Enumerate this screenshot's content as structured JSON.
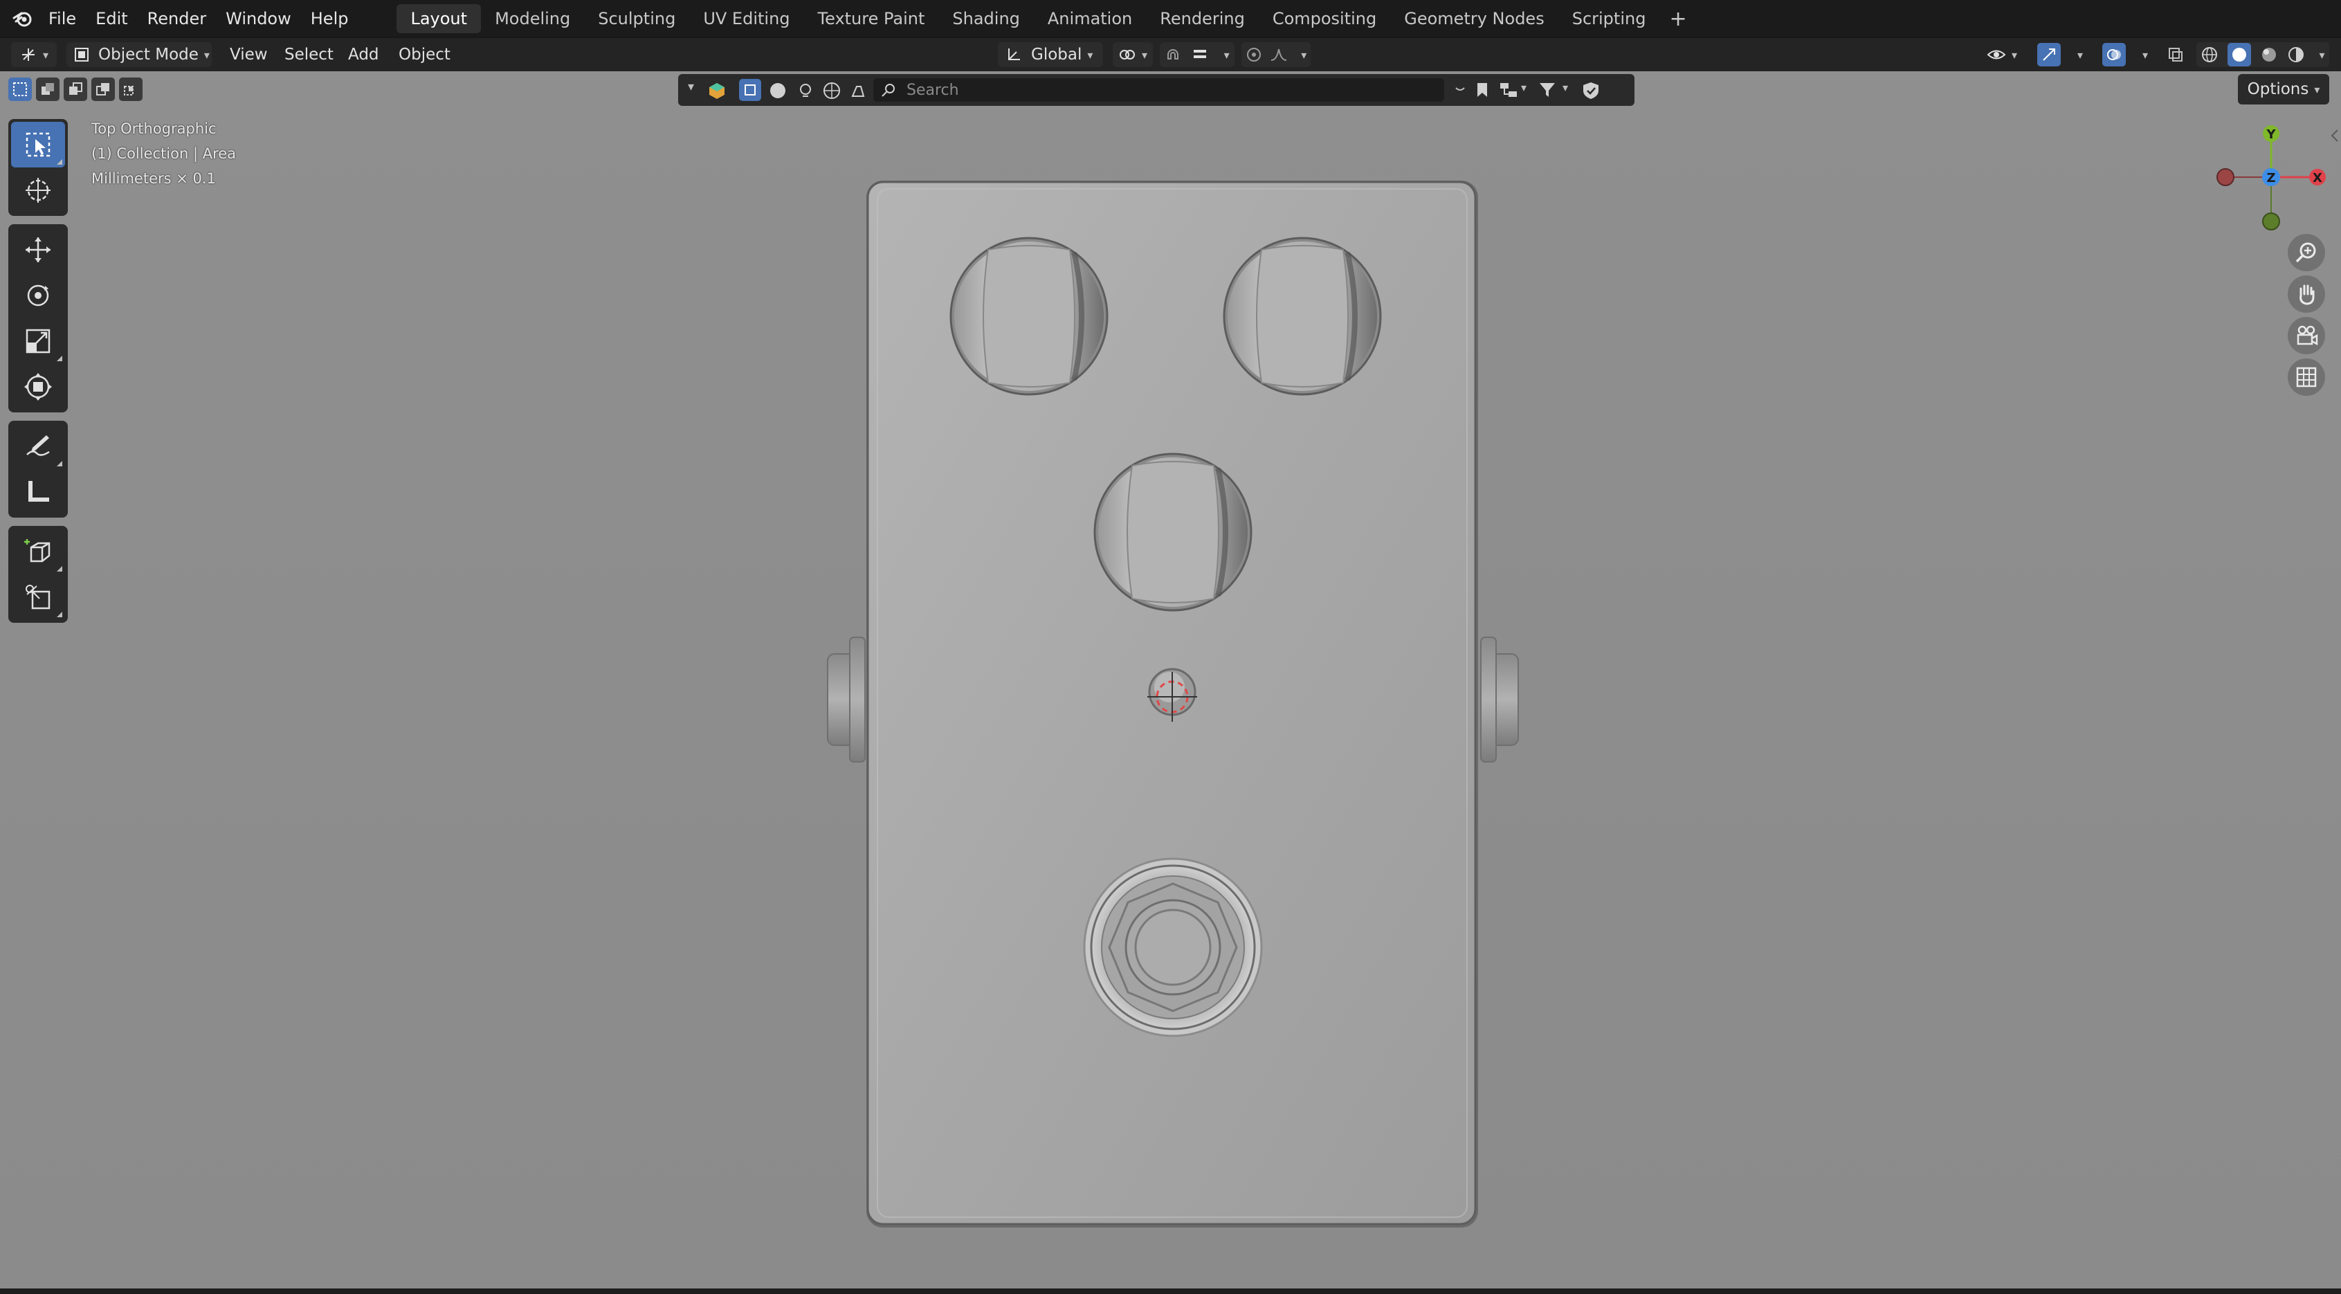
{
  "topbar": {
    "menus": [
      "File",
      "Edit",
      "Render",
      "Window",
      "Help"
    ],
    "workspaces": [
      "Layout",
      "Modeling",
      "Sculpting",
      "UV Editing",
      "Texture Paint",
      "Shading",
      "Animation",
      "Rendering",
      "Compositing",
      "Geometry Nodes",
      "Scripting"
    ],
    "active_workspace": "Layout",
    "add_label": "+"
  },
  "header": {
    "mode": "Object Mode",
    "menus": [
      "View",
      "Select",
      "Add",
      "Object"
    ],
    "orientation": "Global"
  },
  "outliner_filter": {
    "search_placeholder": "Search"
  },
  "viewport": {
    "options_label": "Options",
    "view_name": "Top Orthographic",
    "collection_info": "(1) Collection | Area",
    "units": "Millimeters × 0.1"
  },
  "gizmo": {
    "y_label": "Y",
    "z_label": "Z",
    "x_label": "X"
  },
  "colors": {
    "accent": "#4772b3",
    "viewport_bg": "#8e8e8e",
    "axis_x": "#e0414a",
    "axis_y": "#7fb82a",
    "axis_z": "#3d8ee8"
  }
}
